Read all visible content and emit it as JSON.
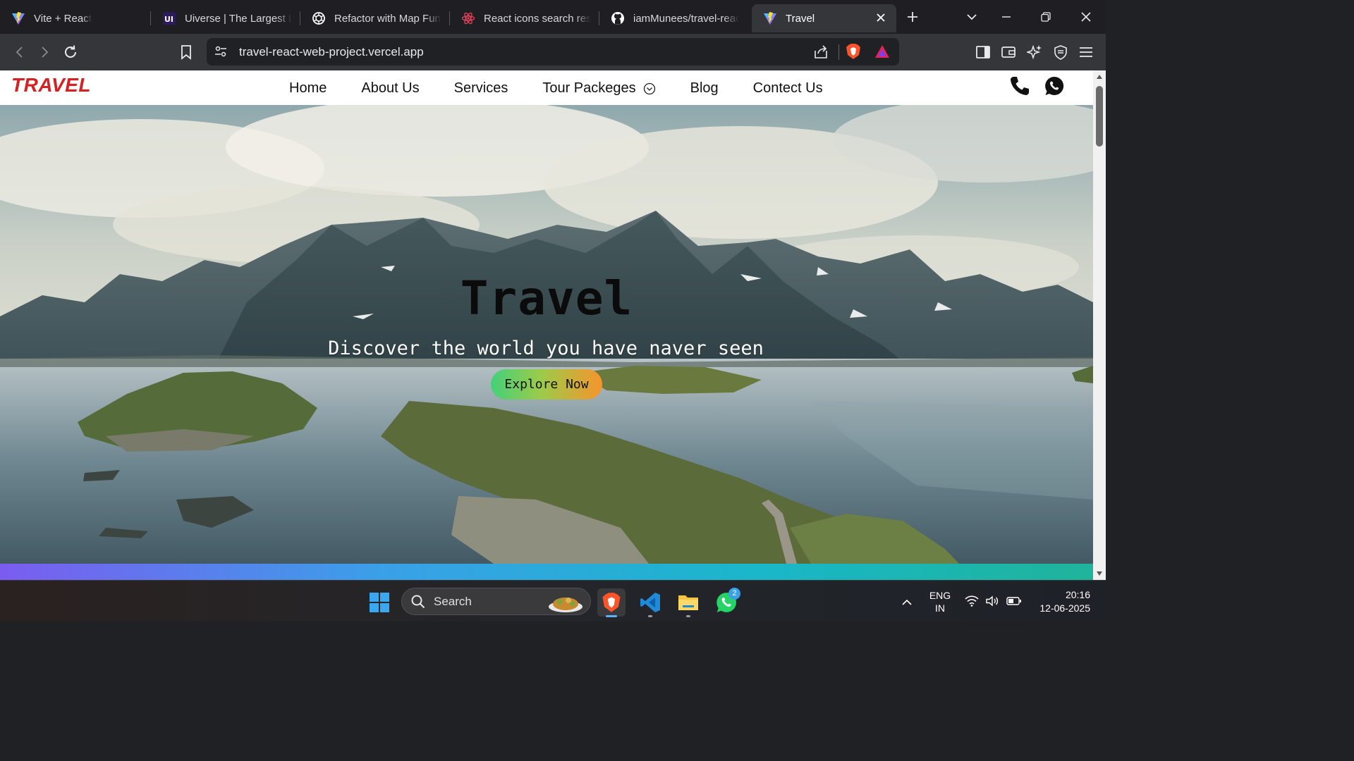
{
  "browser": {
    "tabs": [
      {
        "title": "Vite + React",
        "icon": "vite-icon",
        "active": false
      },
      {
        "title": "Uiverse | The Largest Library of Open-Source UI",
        "icon": "uiverse-icon",
        "active": false
      },
      {
        "title": "Refactor with Map Function",
        "icon": "chatgpt-icon",
        "active": false
      },
      {
        "title": "React icons search results",
        "icon": "react-icon",
        "active": false
      },
      {
        "title": "iamMunees/travel-react-web-project",
        "icon": "github-icon",
        "active": false
      },
      {
        "title": "Travel",
        "icon": "vite-icon",
        "active": true
      }
    ],
    "new_tab": "+",
    "address": "travel-react-web-project.vercel.app"
  },
  "site": {
    "logo": "TRAVEL",
    "nav": [
      "Home",
      "About Us",
      "Services",
      "Tour Packeges",
      "Blog",
      "Contect Us"
    ],
    "hero": {
      "title": "Travel",
      "subtitle": "Discover the world you have naver seen",
      "button": "Explore Now"
    }
  },
  "taskbar": {
    "search": "Search",
    "whatsapp_badge": "2",
    "lang_primary": "ENG",
    "lang_secondary": "IN",
    "time": "20:16",
    "date": "12-06-2025"
  },
  "colors": {
    "logo": "#d42222",
    "explore_gradient": [
      "#44d07a",
      "#f7942c"
    ],
    "rainbow_bar": [
      "#7b5cf0",
      "#1fb49a"
    ]
  }
}
